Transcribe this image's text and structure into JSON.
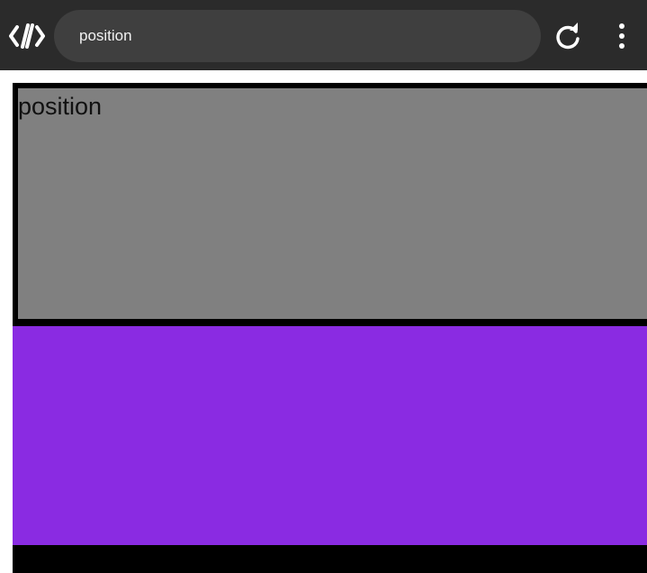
{
  "toolbar": {
    "logo_icon": "code-brackets-logo-icon",
    "url_text": "position",
    "reload_icon": "reload-icon",
    "menu_icon": "more-vertical-icon"
  },
  "page": {
    "box_text": "position",
    "colors": {
      "toolbar_bg": "#2b2b2b",
      "url_bar_bg": "#3f3f3f",
      "frame": "#000000",
      "gray_box": "#808080",
      "purple_box": "#8a2be2"
    }
  }
}
